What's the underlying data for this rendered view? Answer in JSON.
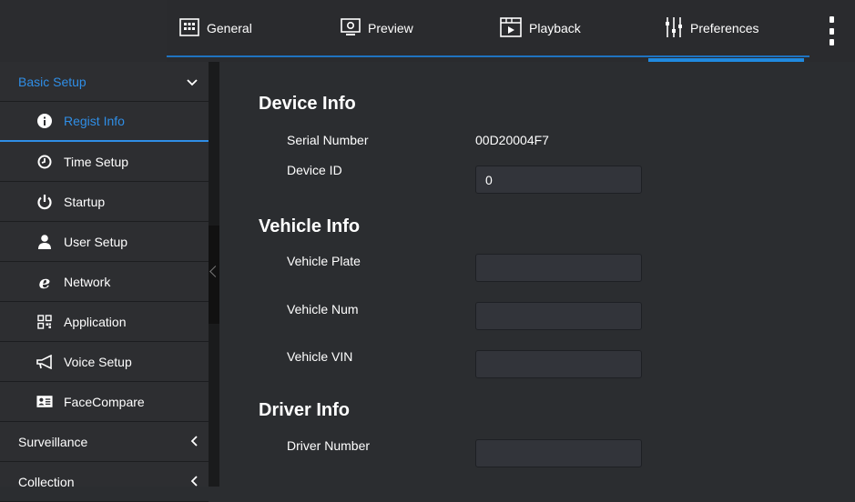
{
  "nav": {
    "tabs": [
      {
        "label": "General",
        "icon": "general-icon"
      },
      {
        "label": "Preview",
        "icon": "monitor-icon"
      },
      {
        "label": "Playback",
        "icon": "playback-icon"
      },
      {
        "label": "Preferences",
        "icon": "sliders-icon"
      }
    ],
    "active_tab": "Preferences"
  },
  "sidebar": {
    "group_label": "Basic Setup",
    "items": [
      {
        "label": "Regist Info",
        "icon": "info-icon"
      },
      {
        "label": "Time Setup",
        "icon": "clock-icon"
      },
      {
        "label": "Startup",
        "icon": "power-icon"
      },
      {
        "label": "User Setup",
        "icon": "user-icon"
      },
      {
        "label": "Network",
        "icon": "network-icon"
      },
      {
        "label": "Application",
        "icon": "apps-icon"
      },
      {
        "label": "Voice Setup",
        "icon": "megaphone-icon"
      },
      {
        "label": "FaceCompare",
        "icon": "id-card-icon"
      }
    ],
    "active_item": "Regist Info",
    "sections": [
      {
        "label": "Surveillance"
      },
      {
        "label": "Collection"
      }
    ]
  },
  "main": {
    "device_info": {
      "title": "Device Info",
      "serial_label": "Serial Number",
      "serial_value": "00D20004F7",
      "device_id_label": "Device ID",
      "device_id_value": "0"
    },
    "vehicle_info": {
      "title": "Vehicle Info",
      "plate_label": "Vehicle Plate",
      "plate_value": "",
      "num_label": "Vehicle Num",
      "num_value": "",
      "vin_label": "Vehicle VIN",
      "vin_value": ""
    },
    "driver_info": {
      "title": "Driver Info",
      "number_label": "Driver Number",
      "number_value": ""
    }
  },
  "colors": {
    "accent": "#2f8ee6",
    "underline": "#1f73c0",
    "background": "#2b2d30"
  }
}
